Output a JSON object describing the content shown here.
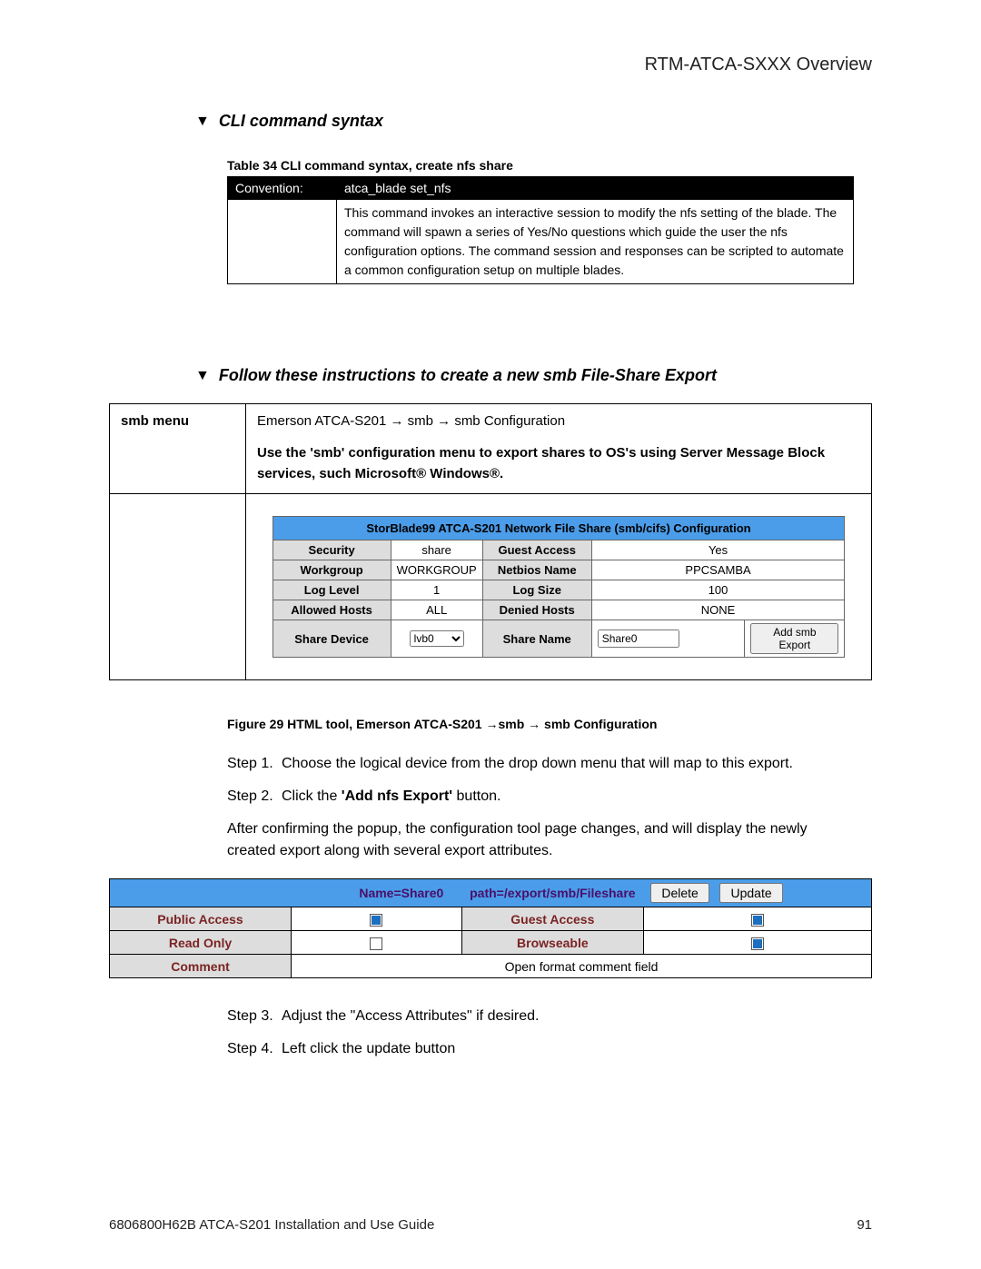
{
  "header": {
    "title": "RTM-ATCA-SXXX Overview"
  },
  "section1": {
    "triangle": "▼",
    "title": "CLI command syntax",
    "table_caption": "Table 34 CLI command syntax, create nfs share",
    "conv_label": "Convention:",
    "conv_value": "atca_blade set_nfs",
    "description": "This command invokes an interactive session to modify the nfs setting of the blade.  The command will spawn a series of Yes/No questions which guide the user the nfs configuration options.  The command session and responses can be scripted to automate a common configuration setup on multiple blades."
  },
  "section2": {
    "triangle": "▼",
    "title": "Follow these instructions to create a new smb File-Share Export",
    "menu_label": "smb menu",
    "breadcrumb": {
      "p1": "Emerson ATCA-S201",
      "arrow": "→",
      "p2": "smb",
      "p3": "smb Configuration"
    },
    "desc_pre": "Use the  ",
    "desc_bold": "'smb'",
    "desc_post": " configuration menu to export shares to OS's using Server Message Block services, such Microsoft® Windows®."
  },
  "cfg": {
    "title": "StorBlade99 ATCA-S201  Network File Share (smb/cifs) Configuration",
    "rows": {
      "r1": {
        "l1": "Security",
        "v1": "share",
        "l2": "Guest Access",
        "v2": "Yes"
      },
      "r2": {
        "l1": "Workgroup",
        "v1": "WORKGROUP",
        "l2": "Netbios Name",
        "v2": "PPCSAMBA"
      },
      "r3": {
        "l1": "Log Level",
        "v1": "1",
        "l2": "Log Size",
        "v2": "100"
      },
      "r4": {
        "l1": "Allowed Hosts",
        "v1": "ALL",
        "l2": "Denied Hosts",
        "v2": "NONE"
      },
      "r5": {
        "l1": "Share Device",
        "select": "lvb0",
        "l2": "Share Name",
        "input": "Share0",
        "button": "Add smb Export"
      }
    }
  },
  "fig_caption": {
    "pre": "Figure 29 HTML tool, Emerson ATCA-S201 ",
    "arrow": "→",
    "mid": "smb ",
    "post": " smb Configuration"
  },
  "steps": {
    "s1": {
      "num": "Step 1.",
      "text": "Choose the logical device from the drop down menu that will map to this export."
    },
    "s2": {
      "num": "Step 2.",
      "pre": "Click the ",
      "bold": "'Add nfs Export'",
      "post": " button."
    },
    "after": "After confirming the popup, the configuration tool page changes, and will display the newly created export along with several export attributes.",
    "s3": {
      "num": "Step 3.",
      "text": "Adjust the \"Access Attributes\" if desired."
    },
    "s4": {
      "num": "Step 4.",
      "text": "Left click the update button"
    }
  },
  "exp": {
    "name_lbl": "Name=Share0",
    "path_lbl": "path=/export/smb/Fileshare",
    "delete": "Delete",
    "update": "Update",
    "r1": {
      "l1": "Public Access",
      "l2": "Guest Access"
    },
    "r2": {
      "l1": "Read Only",
      "l2": "Browseable"
    },
    "r3": {
      "l1": "Comment",
      "val": "Open format comment field"
    }
  },
  "footer": {
    "left": "6806800H62B ATCA-S201 Installation and Use Guide",
    "right": "91"
  }
}
